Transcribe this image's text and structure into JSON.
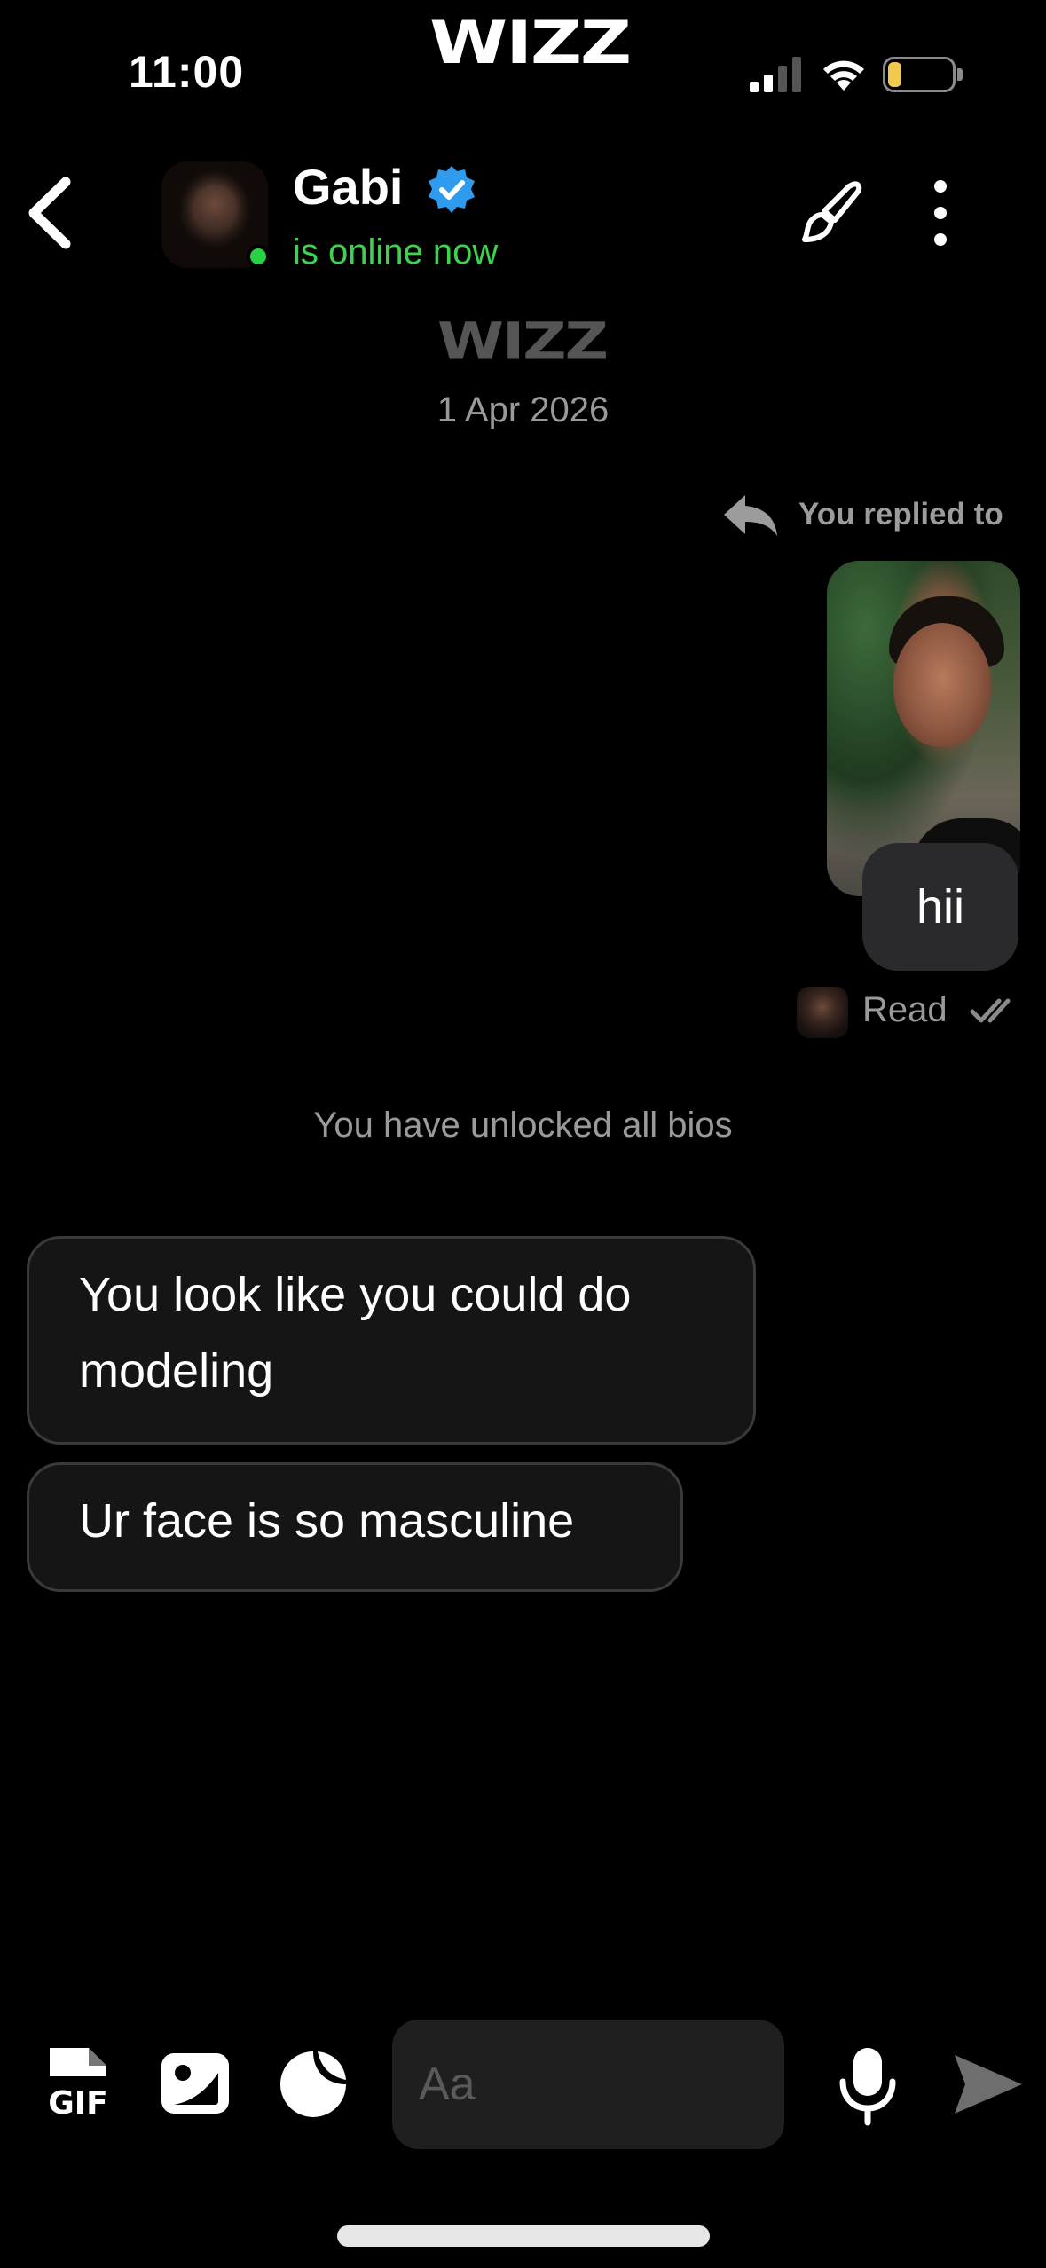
{
  "status_bar": {
    "time": "11:00",
    "battery_level": "11",
    "app_logo": "WIZZ"
  },
  "header": {
    "contact_name": "Gabi",
    "online_status": "is online now",
    "verified": true,
    "icons": [
      "back-arrow-icon",
      "verified-badge-icon",
      "brush-icon",
      "more-vertical-icon"
    ]
  },
  "chat": {
    "logo": "WIZZ",
    "date": "1 Apr 2026",
    "reply_label": "You replied to",
    "sent_message": "hii",
    "read_label": "Read",
    "system_message": "You have unlocked all bios",
    "received_messages": [
      "You look like you could do modeling",
      "Ur face is so masculine"
    ]
  },
  "composer": {
    "placeholder": "Aa",
    "gif_label": "GIF",
    "icons": [
      "gif-icon",
      "image-icon",
      "sticker-icon",
      "microphone-icon",
      "send-icon"
    ]
  },
  "colors": {
    "background": "#000000",
    "online_green": "#3fd150",
    "verified_blue": "#2f9bef",
    "bubble_sent": "#2a2a2c",
    "bubble_received": "#151515",
    "muted_text": "#9a9a9a"
  }
}
